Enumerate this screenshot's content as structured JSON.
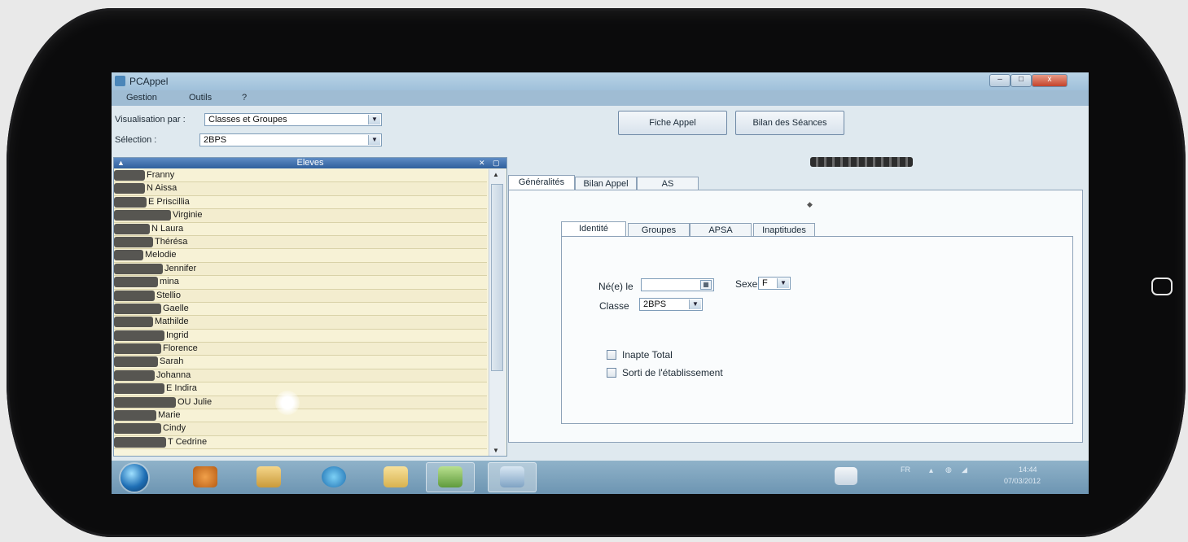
{
  "window": {
    "title": "PCAppel",
    "min_symbol": "–",
    "max_symbol": "□",
    "close_symbol": "x"
  },
  "menu": {
    "items": [
      "Gestion",
      "Outils",
      "?"
    ]
  },
  "filters": {
    "view_label": "Visualisation par :",
    "view_value": "Classes et Groupes",
    "selection_label": "Sélection :",
    "selection_value": "2BPS"
  },
  "actions": {
    "fiche_appel": "Fiche Appel",
    "bilan_seances": "Bilan des Séances"
  },
  "students": {
    "header": "Eleves",
    "names": [
      "Franny",
      "N Aissa",
      "E Priscillia",
      "Virginie",
      "N Laura",
      "Thérésa",
      "Melodie",
      "Jennifer",
      "mina",
      "Stellio",
      "Gaelle",
      "Mathilde",
      "Ingrid",
      "Florence",
      "Sarah",
      "Johanna",
      "E Indira",
      "OU Julie",
      "Marie",
      "Cindy",
      "T Cedrine"
    ]
  },
  "main_tabs": [
    "Généralités",
    "Bilan Appel",
    "AS"
  ],
  "sub_tabs": [
    "Identité",
    "Groupes",
    "APSA",
    "Inaptitudes"
  ],
  "identite": {
    "born_label": "Né(e) le",
    "sex_label": "Sexe",
    "sex_value": "F",
    "class_label": "Classe",
    "class_value": "2BPS",
    "inapte_total": "Inapte Total",
    "sorti": "Sorti de l'établissement"
  },
  "tray": {
    "lang": "FR",
    "time": "14:44",
    "date": "07/03/2012"
  },
  "colors": {
    "list_bg": "#f8f4dc",
    "header_blue": "#2f5f9c",
    "taskbar": "#7fa4bd"
  }
}
